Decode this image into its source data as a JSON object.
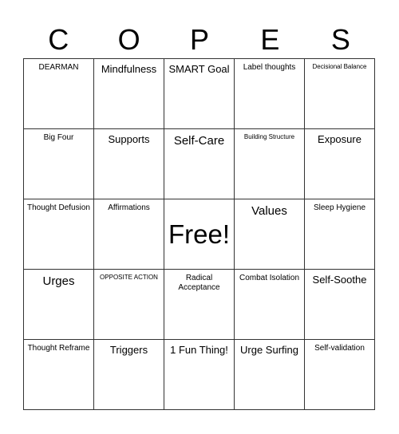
{
  "title_letters": [
    "C",
    "O",
    "P",
    "E",
    "S"
  ],
  "cells": [
    [
      "DEARMAN",
      "Mindfulness",
      "SMART Goal",
      "Label thoughts",
      "Decisional Balance"
    ],
    [
      "Big Four",
      "Supports",
      "Self-Care",
      "Building Structure",
      "Exposure"
    ],
    [
      "Thought Defusion",
      "Affirmations",
      "Free!",
      "Values",
      "Sleep Hygiene"
    ],
    [
      "Urges",
      "OPPOSITE ACTION",
      "Radical Acceptance",
      "Combat Isolation",
      "Self-Soothe"
    ],
    [
      "Thought Reframe",
      "Triggers",
      "1 Fun Thing!",
      "Urge Surfing",
      "Self-validation"
    ]
  ]
}
